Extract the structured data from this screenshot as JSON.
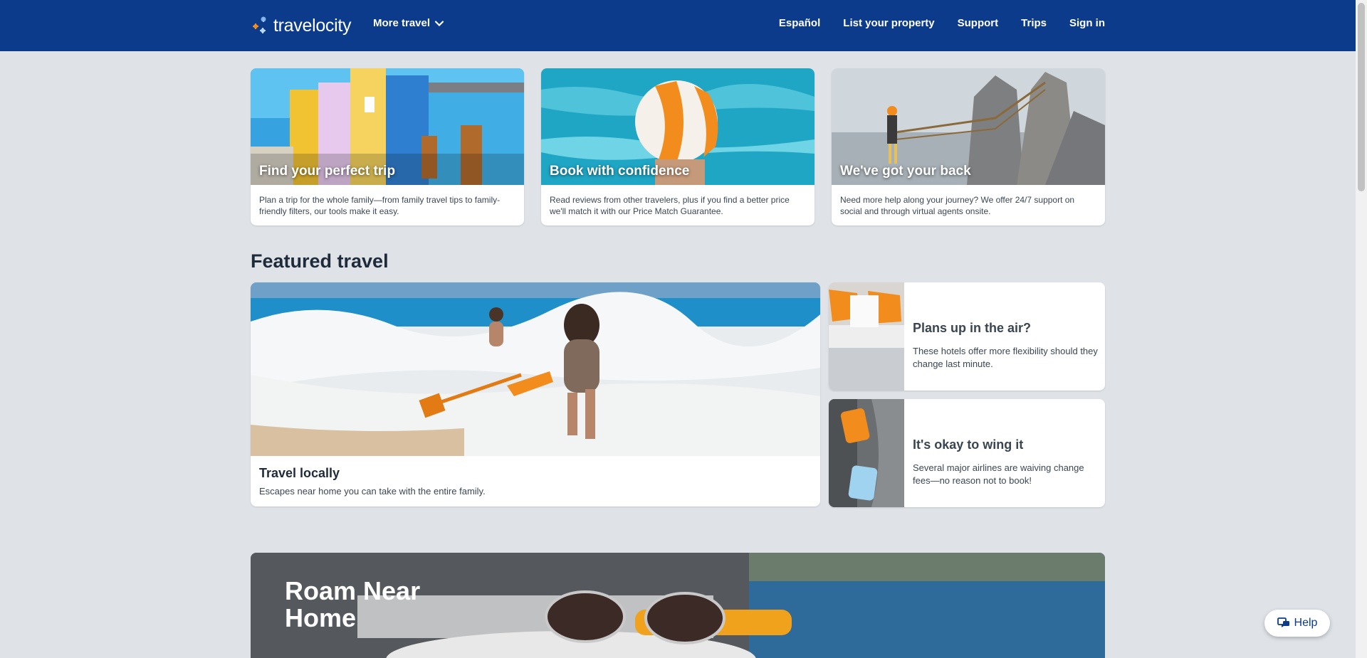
{
  "header": {
    "brand": "travelocity",
    "more_travel": "More travel",
    "nav": [
      "Español",
      "List your property",
      "Support",
      "Trips",
      "Sign in"
    ]
  },
  "promos": [
    {
      "title": "Find your perfect trip",
      "desc_lines": [
        "Plan a trip for the whole family—from family travel tips to family-",
        "friendly filters, our tools make it easy."
      ]
    },
    {
      "title": "Book with confidence",
      "desc_lines": [
        "Read reviews from other travelers, plus if you find a better price",
        "we'll match it with our Price Match Guarantee."
      ]
    },
    {
      "title": "We've got your back",
      "desc_lines": [
        "Need more help along your journey? We offer 24/7 support on",
        "social and through virtual agents onsite."
      ]
    }
  ],
  "featured": {
    "heading": "Featured travel",
    "main": {
      "title": "Travel locally",
      "desc": "Escapes near home you can take with the entire family."
    },
    "side": [
      {
        "title": "Plans up in the air?",
        "desc": "These hotels offer more flexibility should they change last minute."
      },
      {
        "title": "It's okay to wing it",
        "desc": "Several major airlines are waiving change fees—no reason not to book!"
      }
    ]
  },
  "banner": {
    "title_lines": [
      "Roam Near",
      "Home"
    ]
  },
  "help": {
    "label": "Help"
  },
  "colors": {
    "header_bg": "#0c3b8c",
    "page_bg": "#dfe3e8",
    "accent_orange": "#f28c1c"
  }
}
